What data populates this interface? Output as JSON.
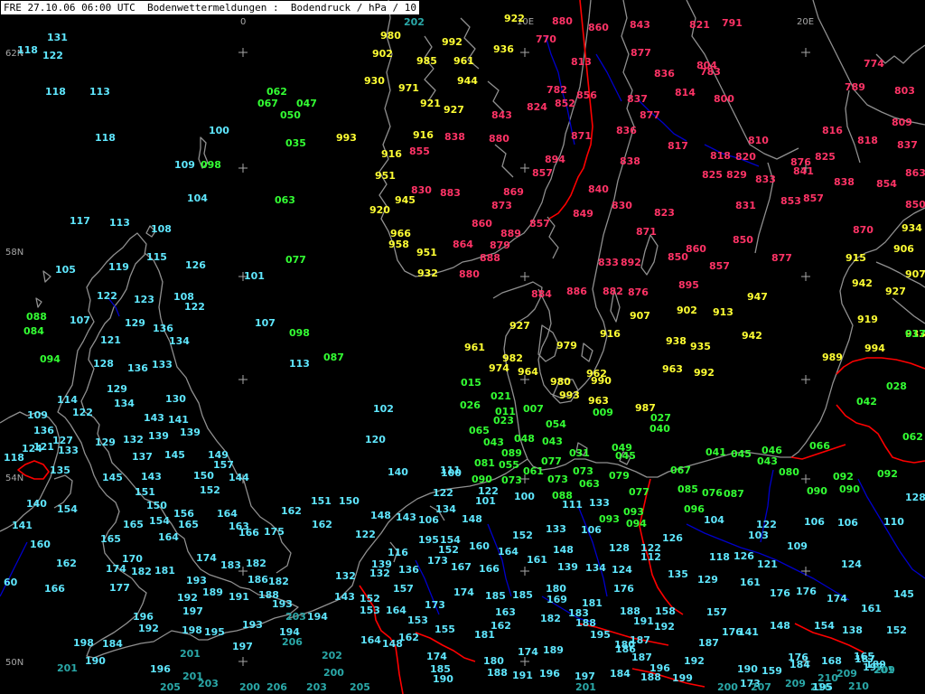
{
  "header": {
    "title": "FRE 27.10.06 06:00 UTC  Bodenwettermeldungen :  Bodendruck / hPa / 10"
  },
  "grid_labels": {
    "lon": [
      "0",
      "10E",
      "20E"
    ],
    "lat": [
      "62N",
      "58N",
      "54N",
      "50N"
    ]
  },
  "colors": {
    "very_high": "#00c8ff",
    "high": "#00ff00",
    "mid": "#ffff00",
    "low": "#ff3366",
    "coast": "#909090",
    "border": "#ff0000",
    "river": "#0000cc"
  },
  "stations": [
    [
      "131",
      "c"
    ],
    [
      "118",
      "c"
    ],
    [
      "122",
      "c"
    ],
    [
      "118",
      "c"
    ],
    [
      "113",
      "c"
    ],
    [
      "118",
      "c"
    ],
    [
      "100",
      "c"
    ],
    [
      "109",
      "c"
    ],
    [
      "098",
      "g"
    ],
    [
      "062",
      "g"
    ],
    [
      "067",
      "g"
    ],
    [
      "047",
      "g"
    ],
    [
      "050",
      "g"
    ],
    [
      "035",
      "g"
    ],
    [
      "063",
      "g"
    ],
    [
      "993",
      "y"
    ],
    [
      "104",
      "c"
    ],
    [
      "117",
      "c"
    ],
    [
      "113",
      "c"
    ],
    [
      "108",
      "c"
    ],
    [
      "105",
      "c"
    ],
    [
      "119",
      "c"
    ],
    [
      "115",
      "c"
    ],
    [
      "126",
      "c"
    ],
    [
      "101",
      "c"
    ],
    [
      "077",
      "g"
    ],
    [
      "088",
      "g"
    ],
    [
      "084",
      "g"
    ],
    [
      "122",
      "c"
    ],
    [
      "107",
      "c"
    ],
    [
      "123",
      "c"
    ],
    [
      "108",
      "c"
    ],
    [
      "122",
      "c"
    ],
    [
      "129",
      "c"
    ],
    [
      "136",
      "c"
    ],
    [
      "121",
      "c"
    ],
    [
      "134",
      "c"
    ],
    [
      "107",
      "c"
    ],
    [
      "098",
      "g"
    ],
    [
      "094",
      "g"
    ],
    [
      "128",
      "c"
    ],
    [
      "136",
      "c"
    ],
    [
      "133",
      "c"
    ],
    [
      "113",
      "c"
    ],
    [
      "087",
      "g"
    ],
    [
      "114",
      "c"
    ],
    [
      "129",
      "c"
    ],
    [
      "134",
      "c"
    ],
    [
      "130",
      "c"
    ],
    [
      "102",
      "c"
    ],
    [
      "109",
      "c"
    ],
    [
      "122",
      "c"
    ],
    [
      "143",
      "c"
    ],
    [
      "141",
      "c"
    ],
    [
      "136",
      "c"
    ],
    [
      "127",
      "c"
    ],
    [
      "121",
      "c"
    ],
    [
      "139",
      "c"
    ],
    [
      "124",
      "c"
    ],
    [
      "133",
      "c"
    ],
    [
      "118",
      "c"
    ],
    [
      "129",
      "c"
    ],
    [
      "132",
      "c"
    ],
    [
      "139",
      "c"
    ],
    [
      "120",
      "c"
    ],
    [
      "137",
      "c"
    ],
    [
      "145",
      "c"
    ],
    [
      "149",
      "c"
    ],
    [
      "157",
      "c"
    ],
    [
      "135",
      "c"
    ],
    [
      "145",
      "c"
    ],
    [
      "143",
      "c"
    ],
    [
      "150",
      "c"
    ],
    [
      "144",
      "c"
    ],
    [
      "140",
      "c"
    ],
    [
      "100",
      "c"
    ],
    [
      "151",
      "c"
    ],
    [
      "152",
      "c"
    ],
    [
      "140",
      "c"
    ],
    [
      "154",
      "c"
    ],
    [
      "162",
      "c"
    ],
    [
      "151",
      "c"
    ],
    [
      "150",
      "c"
    ],
    [
      "150",
      "c"
    ],
    [
      "156",
      "c"
    ],
    [
      "164",
      "c"
    ],
    [
      "141",
      "c"
    ],
    [
      "165",
      "c"
    ],
    [
      "154",
      "c"
    ],
    [
      "165",
      "c"
    ],
    [
      "163",
      "c"
    ],
    [
      "162",
      "c"
    ],
    [
      "160",
      "c"
    ],
    [
      "165",
      "c"
    ],
    [
      "164",
      "c"
    ],
    [
      "166",
      "c"
    ],
    [
      "175",
      "c"
    ],
    [
      "170",
      "c"
    ],
    [
      "174",
      "c"
    ],
    [
      "162",
      "c"
    ],
    [
      "174",
      "c"
    ],
    [
      "182",
      "c"
    ],
    [
      "181",
      "c"
    ],
    [
      "183",
      "c"
    ],
    [
      "60",
      "c"
    ],
    [
      "166",
      "c"
    ],
    [
      "177",
      "c"
    ],
    [
      "193",
      "c"
    ],
    [
      "186",
      "c"
    ],
    [
      "182",
      "c"
    ],
    [
      "182",
      "c"
    ],
    [
      "189",
      "c"
    ],
    [
      "191",
      "c"
    ],
    [
      "188",
      "c"
    ],
    [
      "192",
      "c"
    ],
    [
      "196",
      "c"
    ],
    [
      "197",
      "c"
    ],
    [
      "192",
      "c"
    ],
    [
      "193",
      "c"
    ],
    [
      "193",
      "c"
    ],
    [
      "198",
      "c"
    ],
    [
      "195",
      "c"
    ],
    [
      "203",
      "t"
    ],
    [
      "194",
      "c"
    ],
    [
      "194",
      "c"
    ],
    [
      "198",
      "c"
    ],
    [
      "184",
      "c"
    ],
    [
      "197",
      "c"
    ],
    [
      "206",
      "t"
    ],
    [
      "201",
      "t"
    ],
    [
      "190",
      "c"
    ],
    [
      "196",
      "c"
    ],
    [
      "201",
      "t"
    ],
    [
      "202",
      "t"
    ],
    [
      "200",
      "t"
    ],
    [
      "201",
      "t"
    ],
    [
      "203",
      "t"
    ],
    [
      "205",
      "t"
    ],
    [
      "200",
      "t"
    ],
    [
      "206",
      "t"
    ],
    [
      "203",
      "t"
    ],
    [
      "205",
      "t"
    ],
    [
      "202",
      "t"
    ],
    [
      "980",
      "y"
    ],
    [
      "992",
      "y"
    ],
    [
      "936",
      "y"
    ],
    [
      "902",
      "y"
    ],
    [
      "985",
      "y"
    ],
    [
      "961",
      "y"
    ],
    [
      "930",
      "y"
    ],
    [
      "971",
      "y"
    ],
    [
      "944",
      "y"
    ],
    [
      "921",
      "y"
    ],
    [
      "927",
      "y"
    ],
    [
      "916",
      "y"
    ],
    [
      "916",
      "y"
    ],
    [
      "951",
      "y"
    ],
    [
      "945",
      "y"
    ],
    [
      "920",
      "y"
    ],
    [
      "966",
      "y"
    ],
    [
      "958",
      "y"
    ],
    [
      "951",
      "y"
    ],
    [
      "932",
      "y"
    ],
    [
      "922",
      "y"
    ],
    [
      "880",
      "r"
    ],
    [
      "860",
      "r"
    ],
    [
      "843",
      "r"
    ],
    [
      "821",
      "r"
    ],
    [
      "791",
      "r"
    ],
    [
      "770",
      "r"
    ],
    [
      "877",
      "r"
    ],
    [
      "813",
      "r"
    ],
    [
      "836",
      "r"
    ],
    [
      "804",
      "r"
    ],
    [
      "783",
      "r"
    ],
    [
      "774",
      "r"
    ],
    [
      "782",
      "r"
    ],
    [
      "856",
      "r"
    ],
    [
      "837",
      "r"
    ],
    [
      "814",
      "r"
    ],
    [
      "800",
      "r"
    ],
    [
      "789",
      "r"
    ],
    [
      "803",
      "r"
    ],
    [
      "824",
      "r"
    ],
    [
      "852",
      "r"
    ],
    [
      "843",
      "r"
    ],
    [
      "877",
      "r"
    ],
    [
      "809",
      "r"
    ],
    [
      "838",
      "r"
    ],
    [
      "880",
      "r"
    ],
    [
      "871",
      "r"
    ],
    [
      "836",
      "r"
    ],
    [
      "817",
      "r"
    ],
    [
      "810",
      "r"
    ],
    [
      "816",
      "r"
    ],
    [
      "818",
      "r"
    ],
    [
      "837",
      "r"
    ],
    [
      "855",
      "r"
    ],
    [
      "894",
      "r"
    ],
    [
      "838",
      "r"
    ],
    [
      "818",
      "r"
    ],
    [
      "820",
      "r"
    ],
    [
      "825",
      "r"
    ],
    [
      "830",
      "r"
    ],
    [
      "883",
      "r"
    ],
    [
      "869",
      "r"
    ],
    [
      "857",
      "r"
    ],
    [
      "840",
      "r"
    ],
    [
      "825",
      "r"
    ],
    [
      "829",
      "r"
    ],
    [
      "833",
      "r"
    ],
    [
      "841",
      "r"
    ],
    [
      "838",
      "r"
    ],
    [
      "854",
      "r"
    ],
    [
      "863",
      "r"
    ],
    [
      "873",
      "r"
    ],
    [
      "860",
      "r"
    ],
    [
      "857",
      "r"
    ],
    [
      "849",
      "r"
    ],
    [
      "830",
      "r"
    ],
    [
      "823",
      "r"
    ],
    [
      "831",
      "r"
    ],
    [
      "853",
      "r"
    ],
    [
      "857",
      "r"
    ],
    [
      "850",
      "r"
    ],
    [
      "889",
      "r"
    ],
    [
      "864",
      "r"
    ],
    [
      "879",
      "r"
    ],
    [
      "871",
      "r"
    ],
    [
      "833",
      "r"
    ],
    [
      "850",
      "r"
    ],
    [
      "870",
      "r"
    ],
    [
      "888",
      "r"
    ],
    [
      "880",
      "r"
    ],
    [
      "892",
      "r"
    ],
    [
      "850",
      "r"
    ],
    [
      "860",
      "r"
    ],
    [
      "857",
      "r"
    ],
    [
      "877",
      "r"
    ],
    [
      "895",
      "r"
    ],
    [
      "884",
      "r"
    ],
    [
      "886",
      "r"
    ],
    [
      "882",
      "r"
    ],
    [
      "876",
      "r"
    ],
    [
      "876",
      "r"
    ],
    [
      "934",
      "y"
    ],
    [
      "906",
      "y"
    ],
    [
      "915",
      "y"
    ],
    [
      "907",
      "y"
    ],
    [
      "942",
      "y"
    ],
    [
      "927",
      "y"
    ],
    [
      "947",
      "y"
    ],
    [
      "919",
      "y"
    ],
    [
      "907",
      "y"
    ],
    [
      "902",
      "y"
    ],
    [
      "913",
      "y"
    ],
    [
      "927",
      "y"
    ],
    [
      "916",
      "y"
    ],
    [
      "942",
      "y"
    ],
    [
      "933",
      "y"
    ],
    [
      "938",
      "y"
    ],
    [
      "935",
      "y"
    ],
    [
      "979",
      "y"
    ],
    [
      "961",
      "y"
    ],
    [
      "982",
      "y"
    ],
    [
      "974",
      "y"
    ],
    [
      "964",
      "y"
    ],
    [
      "962",
      "y"
    ],
    [
      "980",
      "y"
    ],
    [
      "990",
      "y"
    ],
    [
      "993",
      "y"
    ],
    [
      "963",
      "y"
    ],
    [
      "963",
      "y"
    ],
    [
      "992",
      "y"
    ],
    [
      "987",
      "y"
    ],
    [
      "989",
      "y"
    ],
    [
      "994",
      "y"
    ],
    [
      "017",
      "g"
    ],
    [
      "015",
      "g"
    ],
    [
      "021",
      "g"
    ],
    [
      "028",
      "g"
    ],
    [
      "042",
      "g"
    ],
    [
      "026",
      "g"
    ],
    [
      "011",
      "g"
    ],
    [
      "007",
      "g"
    ],
    [
      "009",
      "g"
    ],
    [
      "027",
      "g"
    ],
    [
      "040",
      "g"
    ],
    [
      "023",
      "g"
    ],
    [
      "054",
      "g"
    ],
    [
      "065",
      "g"
    ],
    [
      "043",
      "g"
    ],
    [
      "048",
      "g"
    ],
    [
      "043",
      "g"
    ],
    [
      "031",
      "g"
    ],
    [
      "049",
      "g"
    ],
    [
      "045",
      "g"
    ],
    [
      "041",
      "g"
    ],
    [
      "045",
      "g"
    ],
    [
      "046",
      "g"
    ],
    [
      "043",
      "g"
    ],
    [
      "066",
      "g"
    ],
    [
      "062",
      "g"
    ],
    [
      "089",
      "g"
    ],
    [
      "081",
      "g"
    ],
    [
      "055",
      "g"
    ],
    [
      "077",
      "g"
    ],
    [
      "061",
      "g"
    ],
    [
      "073",
      "g"
    ],
    [
      "063",
      "g"
    ],
    [
      "067",
      "g"
    ],
    [
      "080",
      "g"
    ],
    [
      "092",
      "g"
    ],
    [
      "092",
      "g"
    ],
    [
      "090",
      "g"
    ],
    [
      "073",
      "g"
    ],
    [
      "073",
      "g"
    ],
    [
      "079",
      "g"
    ],
    [
      "077",
      "g"
    ],
    [
      "085",
      "g"
    ],
    [
      "076",
      "g"
    ],
    [
      "087",
      "g"
    ],
    [
      "090",
      "g"
    ],
    [
      "090",
      "g"
    ],
    [
      "088",
      "g"
    ],
    [
      "093",
      "g"
    ],
    [
      "093",
      "g"
    ],
    [
      "094",
      "g"
    ],
    [
      "096",
      "g"
    ],
    [
      "104",
      "c"
    ],
    [
      "122",
      "c"
    ],
    [
      "122",
      "c"
    ],
    [
      "101",
      "c"
    ],
    [
      "100",
      "c"
    ],
    [
      "111",
      "c"
    ],
    [
      "111",
      "c"
    ],
    [
      "133",
      "c"
    ],
    [
      "134",
      "c"
    ],
    [
      "148",
      "c"
    ],
    [
      "148",
      "c"
    ],
    [
      "143",
      "c"
    ],
    [
      "106",
      "c"
    ],
    [
      "106",
      "c"
    ],
    [
      "122",
      "c"
    ],
    [
      "103",
      "c"
    ],
    [
      "106",
      "c"
    ],
    [
      "106",
      "c"
    ],
    [
      "110",
      "c"
    ],
    [
      "128",
      "c"
    ],
    [
      "122",
      "c"
    ],
    [
      "195",
      "c"
    ],
    [
      "154",
      "c"
    ],
    [
      "152",
      "c"
    ],
    [
      "160",
      "c"
    ],
    [
      "152",
      "c"
    ],
    [
      "133",
      "c"
    ],
    [
      "126",
      "c"
    ],
    [
      "109",
      "c"
    ],
    [
      "116",
      "c"
    ],
    [
      "164",
      "c"
    ],
    [
      "148",
      "c"
    ],
    [
      "128",
      "c"
    ],
    [
      "122",
      "c"
    ],
    [
      "112",
      "c"
    ],
    [
      "118",
      "c"
    ],
    [
      "126",
      "c"
    ],
    [
      "121",
      "c"
    ],
    [
      "124",
      "c"
    ],
    [
      "139",
      "c"
    ],
    [
      "173",
      "c"
    ],
    [
      "167",
      "c"
    ],
    [
      "166",
      "c"
    ],
    [
      "161",
      "c"
    ],
    [
      "139",
      "c"
    ],
    [
      "134",
      "c"
    ],
    [
      "124",
      "c"
    ],
    [
      "135",
      "c"
    ],
    [
      "129",
      "c"
    ],
    [
      "161",
      "c"
    ],
    [
      "176",
      "c"
    ],
    [
      "176",
      "c"
    ],
    [
      "174",
      "c"
    ],
    [
      "161",
      "c"
    ],
    [
      "145",
      "c"
    ],
    [
      "132",
      "c"
    ],
    [
      "132",
      "c"
    ],
    [
      "136",
      "c"
    ],
    [
      "143",
      "c"
    ],
    [
      "152",
      "c"
    ],
    [
      "157",
      "c"
    ],
    [
      "173",
      "c"
    ],
    [
      "174",
      "c"
    ],
    [
      "185",
      "c"
    ],
    [
      "185",
      "c"
    ],
    [
      "180",
      "c"
    ],
    [
      "181",
      "c"
    ],
    [
      "176",
      "c"
    ],
    [
      "169",
      "c"
    ],
    [
      "158",
      "c"
    ],
    [
      "157",
      "c"
    ],
    [
      "141",
      "c"
    ],
    [
      "148",
      "c"
    ],
    [
      "154",
      "c"
    ],
    [
      "138",
      "c"
    ],
    [
      "152",
      "c"
    ],
    [
      "153",
      "c"
    ],
    [
      "164",
      "c"
    ],
    [
      "153",
      "c"
    ],
    [
      "162",
      "c"
    ],
    [
      "163",
      "c"
    ],
    [
      "182",
      "c"
    ],
    [
      "183",
      "c"
    ],
    [
      "188",
      "c"
    ],
    [
      "188",
      "c"
    ],
    [
      "191",
      "c"
    ],
    [
      "192",
      "c"
    ],
    [
      "187",
      "c"
    ],
    [
      "173",
      "c"
    ],
    [
      "159",
      "c"
    ],
    [
      "155",
      "c"
    ],
    [
      "174",
      "c"
    ],
    [
      "162",
      "c"
    ],
    [
      "148",
      "c"
    ],
    [
      "164",
      "c"
    ],
    [
      "181",
      "c"
    ],
    [
      "195",
      "c"
    ],
    [
      "180",
      "c"
    ],
    [
      "187",
      "c"
    ],
    [
      "176",
      "c"
    ],
    [
      "176",
      "c"
    ],
    [
      "168",
      "c"
    ],
    [
      "165",
      "c"
    ],
    [
      "197",
      "c"
    ],
    [
      "201",
      "t"
    ],
    [
      "185",
      "c"
    ],
    [
      "180",
      "c"
    ],
    [
      "174",
      "c"
    ],
    [
      "189",
      "c"
    ],
    [
      "186",
      "c"
    ],
    [
      "187",
      "c"
    ],
    [
      "196",
      "c"
    ],
    [
      "192",
      "c"
    ],
    [
      "190",
      "c"
    ],
    [
      "184",
      "c"
    ],
    [
      "187",
      "c"
    ],
    [
      "189",
      "c"
    ],
    [
      "188",
      "c"
    ],
    [
      "190",
      "c"
    ],
    [
      "191",
      "c"
    ],
    [
      "196",
      "c"
    ],
    [
      "197",
      "c"
    ],
    [
      "184",
      "c"
    ],
    [
      "188",
      "c"
    ],
    [
      "199",
      "c"
    ],
    [
      "200",
      "t"
    ],
    [
      "207",
      "t"
    ],
    [
      "209",
      "t"
    ],
    [
      "210",
      "t"
    ],
    [
      "209",
      "t"
    ],
    [
      "209",
      "t"
    ],
    [
      "210",
      "t"
    ],
    [
      "216",
      "t"
    ],
    [
      "195",
      "c"
    ],
    [
      "201",
      "t"
    ],
    [
      "201",
      "t"
    ],
    [
      "200",
      "t"
    ],
    [
      "192",
      "c"
    ],
    [
      "193",
      "c"
    ],
    [
      "193",
      "c"
    ],
    [
      "204",
      "t"
    ]
  ]
}
